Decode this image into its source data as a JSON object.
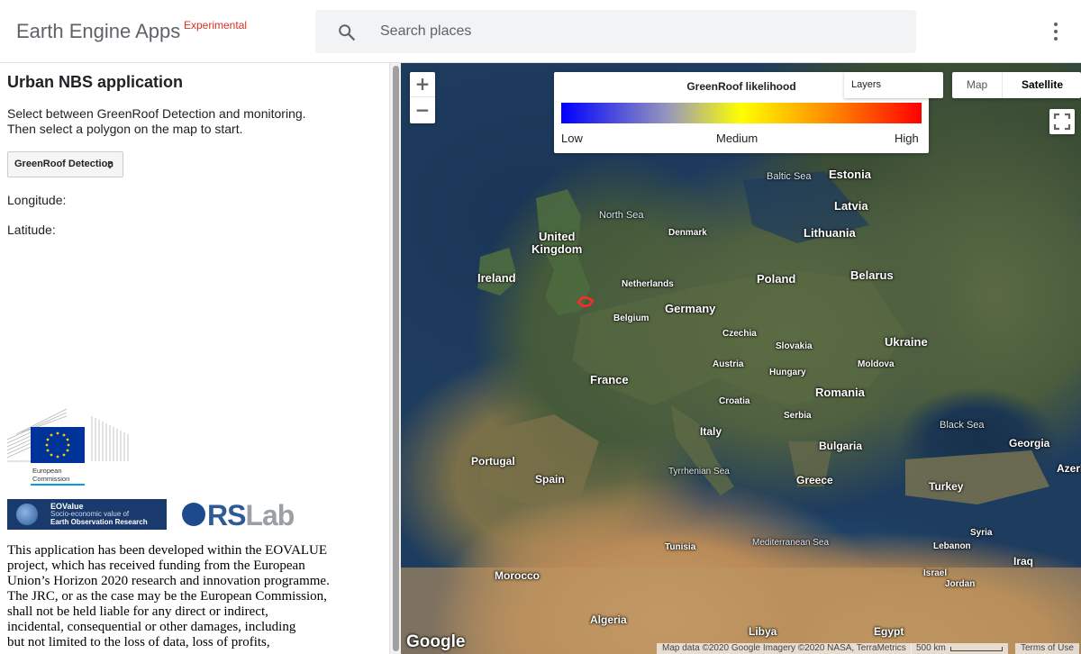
{
  "header": {
    "brand": "Earth Engine Apps",
    "brand_tag": "Experimental",
    "search_placeholder": "Search places"
  },
  "panel": {
    "title": "Urban NBS application",
    "description": "Select between GreenRoof Detection and  monitoring.\nThen select a polygon on the map to start.",
    "select_value": "GreenRoof Detection",
    "longitude_label": "Longitude:",
    "latitude_label": "Latitude:",
    "ec_logo_text": "European\nCommission",
    "eovalue_logo": {
      "line1": "EOValue",
      "line2": "Socio-economic value of",
      "line3": "Earth Observation Research"
    },
    "rslab_logo": {
      "part1": "RS",
      "part2": "Lab"
    },
    "disclaimer": "This application has been developed within the EOVALUE\nproject, which has received funding from the European\nUnion’s Horizon 2020 research and innovation programme.\nThe JRC, or as the case may be the European Commission,\nshall not be held liable for any direct or indirect,\nincidental, consequential or other damages, including\nbut not limited to the loss of data, loss of profits,"
  },
  "map": {
    "zoom_in": "+",
    "zoom_out": "−",
    "legend": {
      "title": "GreenRoof likelihood",
      "low": "Low",
      "medium": "Medium",
      "high": "High"
    },
    "layers_label": "Layers",
    "maptype": {
      "map": "Map",
      "satellite": "Satellite",
      "selected": "Satellite"
    },
    "google_logo": "Google",
    "attribution": "Map data ©2020 Google Imagery ©2020 NASA, TerraMetrics",
    "scale": "500 km",
    "terms": "Terms of Use",
    "marker_color": "#ff2a2a",
    "labels": {
      "baltic_sea": "Baltic Sea",
      "estonia": "Estonia",
      "latvia": "Latvia",
      "north_sea": "North Sea",
      "uk": "United\nKingdom",
      "denmark": "Denmark",
      "lithuania": "Lithuania",
      "ireland": "Ireland",
      "belarus": "Belarus",
      "netherlands": "Netherlands",
      "poland": "Poland",
      "germany": "Germany",
      "belgium": "Belgium",
      "czechia": "Czechia",
      "ukraine": "Ukraine",
      "slovakia": "Slovakia",
      "austria": "Austria",
      "moldova": "Moldova",
      "hungary": "Hungary",
      "france": "France",
      "romania": "Romania",
      "croatia": "Croatia",
      "serbia": "Serbia",
      "black_sea": "Black Sea",
      "italy": "Italy",
      "bulgaria": "Bulgaria",
      "georgia": "Georgia",
      "azerb": "Azerb",
      "portugal": "Portugal",
      "tyrrhenian_sea": "Tyrrhenian Sea",
      "spain": "Spain",
      "greece": "Greece",
      "turkey": "Turkey",
      "syria": "Syria",
      "tunisia": "Tunisia",
      "mediterranean_sea": "Mediterranean Sea",
      "lebanon": "Lebanon",
      "iraq": "Iraq",
      "morocco": "Morocco",
      "israel": "Israel",
      "jordan": "Jordan",
      "algeria": "Algeria",
      "libya": "Libya",
      "egypt": "Egypt"
    }
  }
}
